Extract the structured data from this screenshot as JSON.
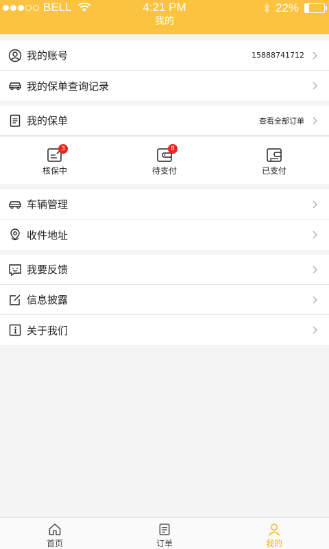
{
  "status_bar": {
    "carrier": "BELL",
    "time": "4:21 PM",
    "battery": "22%",
    "battery_level": 0.22
  },
  "header": {
    "title": "我的"
  },
  "account": {
    "label": "我的账号",
    "phone": "15888741712"
  },
  "query_records": {
    "label": "我的保单查询记录"
  },
  "policy": {
    "label": "我的保单",
    "view_all": "查看全部订单",
    "statuses": [
      {
        "label": "核保中",
        "badge": "3"
      },
      {
        "label": "待支付",
        "badge": "8"
      },
      {
        "label": "已支付"
      }
    ]
  },
  "vehicle": {
    "label": "车辆管理"
  },
  "address": {
    "label": "收件地址"
  },
  "feedback": {
    "label": "我要反馈"
  },
  "disclosure": {
    "label": "信息披露"
  },
  "about": {
    "label": "关于我们"
  },
  "tabs": [
    {
      "label": "首页",
      "icon": "home-icon"
    },
    {
      "label": "订单",
      "icon": "order-icon"
    },
    {
      "label": "我的",
      "icon": "profile-icon",
      "active": true
    }
  ],
  "colors": {
    "accent": "#fcc341",
    "active_tab": "#f5b520",
    "badge": "#e4281e"
  }
}
